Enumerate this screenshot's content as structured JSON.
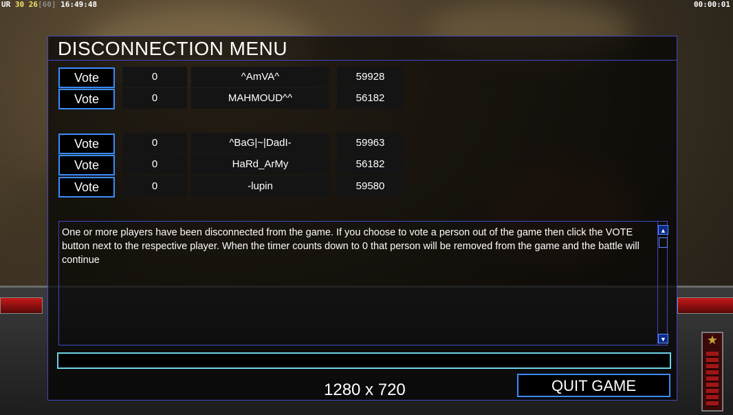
{
  "hud": {
    "left_prefix": "UR",
    "left_a": "30",
    "left_b": "26",
    "left_c": "[60]",
    "clock": "16:49:48",
    "timer": "00:00:01"
  },
  "menu": {
    "title": "DISCONNECTION MENU",
    "vote_label": "Vote",
    "players": [
      {
        "votes": "0",
        "name": "^AmVA^",
        "ping": "59928"
      },
      {
        "votes": "0",
        "name": "MAHMOUD^^",
        "ping": "56182"
      },
      {
        "votes": "0",
        "name": "^BaG|~|DadI-",
        "ping": "59963"
      },
      {
        "votes": "0",
        "name": "HaRd_ArMy",
        "ping": "56182"
      },
      {
        "votes": "0",
        "name": "-lupin",
        "ping": "59580"
      }
    ],
    "message": "One or more players have been disconnected from the game. If you choose to vote a person out of the game then click the VOTE button next to the respective player. When the timer counts down to 0 that person will be removed from the game and the battle will continue",
    "chat_value": "",
    "resolution": "1280 x 720",
    "quit_label": "QUIT GAME"
  },
  "colors": {
    "panel_border": "#3e48c8",
    "button_border": "#3a8dff",
    "chat_border": "#6ed4e8"
  }
}
